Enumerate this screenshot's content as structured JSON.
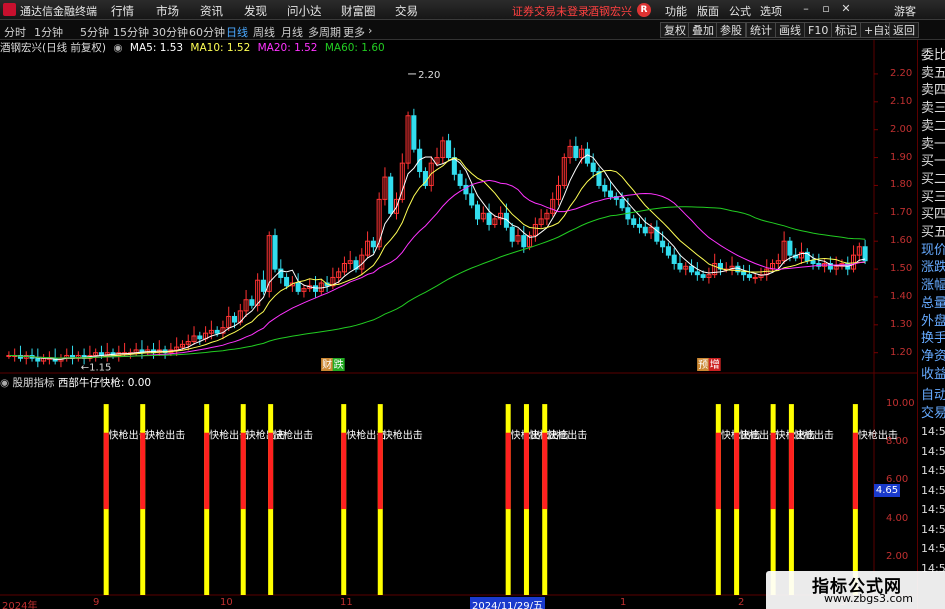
{
  "menubar": {
    "app_title": "通达信金融终端",
    "menus": [
      "行情",
      "市场",
      "资讯",
      "发现",
      "问小达",
      "财富圈",
      "交易"
    ],
    "alert": "证券交易未登录",
    "stock_name": "酒钢宏兴",
    "right_items": [
      "功能",
      "版面",
      "公式",
      "选项"
    ],
    "guest_label": "游客"
  },
  "toolbar": {
    "timeframes": [
      "分时",
      "1分钟",
      "5分钟",
      "15分钟",
      "30分钟",
      "60分钟",
      "日线",
      "周线",
      "月线",
      "多周期",
      "更多"
    ],
    "active_timeframe": "日线",
    "buttons": [
      "复权",
      "叠加",
      "参股",
      "统计",
      "画线",
      "F10",
      "标记",
      "+自选",
      "返回"
    ]
  },
  "info_line": {
    "title": "酒钢宏兴(日线 前复权)",
    "ma5": "MA5: 1.53",
    "ma10": "MA10: 1.52",
    "ma20": "MA20: 1.52",
    "ma60": "MA60: 1.60"
  },
  "price_axis": [
    "2.20",
    "2.10",
    "2.00",
    "1.90",
    "1.80",
    "1.70",
    "1.60",
    "1.50",
    "1.40",
    "1.30",
    "1.20"
  ],
  "annotations": {
    "high": "2.20",
    "low": "1.15",
    "event_a": "财",
    "event_b": "跌",
    "event_c": "预",
    "event_d": "增"
  },
  "indicator": {
    "name": "股朋指标",
    "formula": "西部牛仔快枪: 0.00",
    "signal_label": "快枪出击",
    "axis": [
      "10.00",
      "8.00",
      "6.00",
      "4.00",
      "2.00"
    ],
    "current_value": "4.65"
  },
  "right_panel": {
    "items": [
      "委比",
      "卖五",
      "卖四",
      "卖三",
      "卖二",
      "卖一",
      "买一",
      "买二",
      "买三",
      "买四",
      "买五",
      "现价",
      "涨跌",
      "涨幅",
      "总量",
      "外盘",
      "换手",
      "净资",
      "收益"
    ],
    "bottom_items": [
      "自动",
      "交易"
    ],
    "times": [
      "14:56",
      "14:56",
      "14:56",
      "14:56",
      "14:56",
      "14:56",
      "14:56",
      "14:56"
    ]
  },
  "x_axis": [
    "2024年",
    "9",
    "10",
    "11",
    "2024/11/29/五",
    "1",
    "2",
    "3"
  ],
  "watermark": {
    "title": "指标公式网",
    "url": "www.zbgs3.com"
  },
  "colors": {
    "up": "#ff3333",
    "down": "#33ddee",
    "ma5": "#ffffff",
    "ma10": "#ffff55",
    "ma20": "#ff33ff",
    "ma60": "#22cc22",
    "signal_bar": "#ffff00",
    "signal_red": "#ff2020"
  },
  "chart_data": {
    "type": "candlestick",
    "ylim": [
      1.12,
      2.25
    ],
    "closes": [
      1.19,
      1.19,
      1.18,
      1.19,
      1.18,
      1.17,
      1.18,
      1.18,
      1.17,
      1.18,
      1.19,
      1.18,
      1.19,
      1.18,
      1.19,
      1.2,
      1.19,
      1.2,
      1.19,
      1.2,
      1.2,
      1.2,
      1.21,
      1.2,
      1.21,
      1.2,
      1.21,
      1.2,
      1.21,
      1.22,
      1.23,
      1.24,
      1.26,
      1.25,
      1.27,
      1.28,
      1.27,
      1.29,
      1.33,
      1.31,
      1.35,
      1.39,
      1.37,
      1.46,
      1.42,
      1.62,
      1.5,
      1.47,
      1.44,
      1.45,
      1.42,
      1.43,
      1.44,
      1.42,
      1.45,
      1.44,
      1.47,
      1.49,
      1.52,
      1.53,
      1.5,
      1.55,
      1.6,
      1.58,
      1.75,
      1.83,
      1.7,
      1.75,
      1.88,
      2.05,
      1.93,
      1.85,
      1.8,
      1.88,
      1.9,
      1.96,
      1.9,
      1.84,
      1.8,
      1.77,
      1.73,
      1.68,
      1.7,
      1.66,
      1.68,
      1.7,
      1.65,
      1.6,
      1.62,
      1.58,
      1.62,
      1.66,
      1.68,
      1.7,
      1.75,
      1.8,
      1.9,
      1.94,
      1.9,
      1.93,
      1.88,
      1.85,
      1.8,
      1.78,
      1.76,
      1.75,
      1.72,
      1.68,
      1.66,
      1.65,
      1.63,
      1.65,
      1.6,
      1.58,
      1.55,
      1.52,
      1.5,
      1.51,
      1.49,
      1.48,
      1.47,
      1.48,
      1.52,
      1.5,
      1.5,
      1.51,
      1.49,
      1.48,
      1.47,
      1.47,
      1.48,
      1.5,
      1.52,
      1.53,
      1.6,
      1.55,
      1.54,
      1.56,
      1.53,
      1.52,
      1.51,
      1.52,
      1.5,
      1.51,
      1.52,
      1.5,
      1.55,
      1.58,
      1.53
    ],
    "signal_indices": [
      5,
      9,
      16,
      20,
      23,
      31,
      35,
      49,
      51,
      53,
      72,
      74,
      78,
      80,
      87
    ],
    "signal_value": 10.0
  }
}
